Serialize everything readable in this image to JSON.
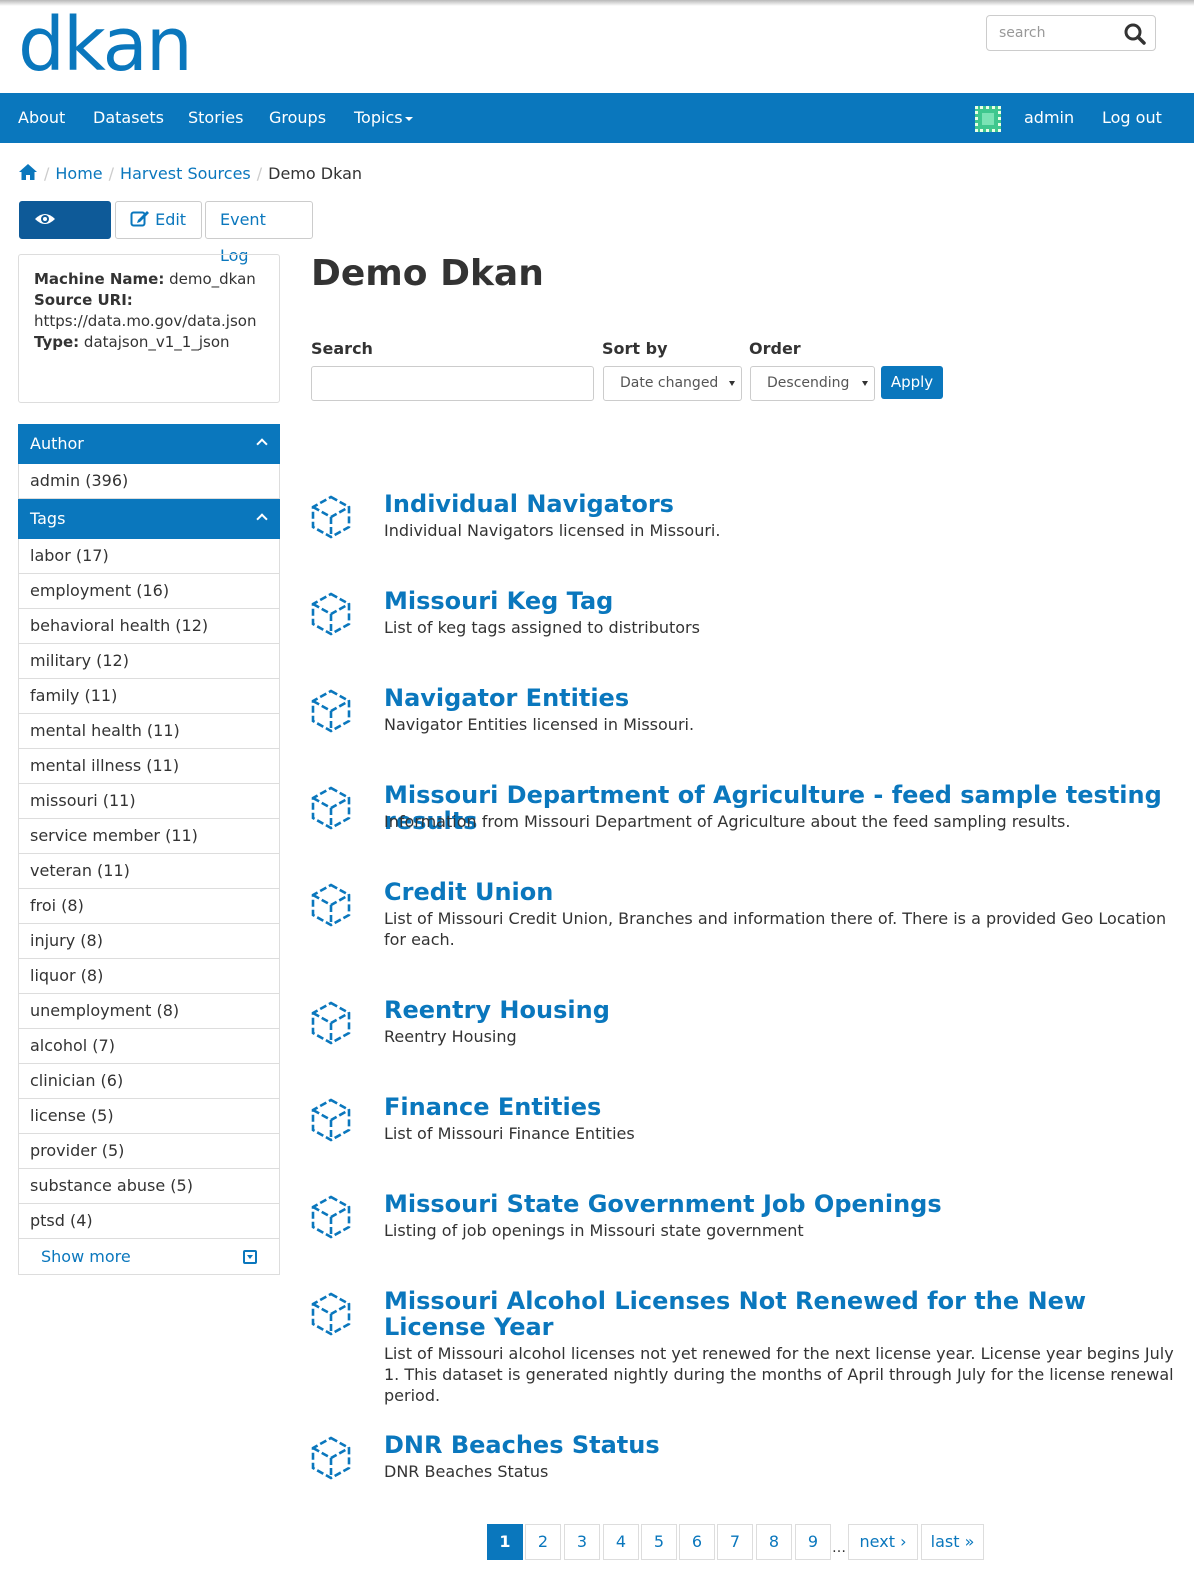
{
  "header": {
    "logo_text": "dkan",
    "search_placeholder": "search"
  },
  "nav": {
    "items": [
      "About",
      "Datasets",
      "Stories",
      "Groups",
      "Topics"
    ],
    "user": "admin",
    "logout": "Log out"
  },
  "breadcrumb": {
    "items": [
      "Home",
      "Harvest Sources"
    ],
    "current": "Demo Dkan"
  },
  "tabs": [
    "View",
    "Edit",
    "Event Log"
  ],
  "info": {
    "machine_name_label": "Machine Name:",
    "machine_name": "demo_dkan",
    "source_uri_label": "Source URI:",
    "source_uri": "https://data.mo.gov/data.json",
    "type_label": "Type:",
    "type": "datajson_v1_1_json"
  },
  "facets": {
    "author_title": "Author",
    "authors": [
      "admin (396)"
    ],
    "tags_title": "Tags",
    "tags": [
      "labor (17)",
      "employment (16)",
      "behavioral health (12)",
      "military (12)",
      "family (11)",
      "mental health (11)",
      "mental illness (11)",
      "missouri (11)",
      "service member (11)",
      "veteran (11)",
      "froi (8)",
      "injury (8)",
      "liquor (8)",
      "unemployment (8)",
      "alcohol (7)",
      "clinician (6)",
      "license (5)",
      "provider (5)",
      "substance abuse (5)",
      "ptsd (4)"
    ],
    "show_more": "Show more"
  },
  "main": {
    "title": "Demo Dkan",
    "filters": {
      "search_label": "Search",
      "sort_label": "Sort by",
      "sort_value": "Date changed",
      "order_label": "Order",
      "order_value": "Descending",
      "apply": "Apply"
    },
    "results": [
      {
        "title": "Individual Navigators",
        "desc": "Individual Navigators licensed in Missouri."
      },
      {
        "title": "Missouri Keg Tag",
        "desc": "List of keg tags assigned to distributors"
      },
      {
        "title": "Navigator Entities",
        "desc": "Navigator Entities licensed in Missouri."
      },
      {
        "title": "Missouri Department of Agriculture - feed sample testing results",
        "desc": "Information from Missouri Department of Agriculture about the feed sampling results."
      },
      {
        "title": "Credit Union",
        "desc": "List of Missouri Credit Union, Branches and information there of. There is a provided Geo Location for each."
      },
      {
        "title": "Reentry Housing",
        "desc": "Reentry Housing"
      },
      {
        "title": "Finance Entities",
        "desc": "List of Missouri Finance Entities"
      },
      {
        "title": "Missouri State Government Job Openings",
        "desc": "Listing of job openings in Missouri state government"
      },
      {
        "title": "Missouri Alcohol Licenses Not Renewed for the New License Year",
        "desc": "List of Missouri alcohol licenses not yet renewed for the next license year. License year begins July 1. This dataset is generated nightly during the months of April through July for the license renewal period."
      },
      {
        "title": "DNR Beaches Status",
        "desc": "DNR Beaches Status"
      }
    ]
  },
  "pager": {
    "pages": [
      "1",
      "2",
      "3",
      "4",
      "5",
      "6",
      "7",
      "8",
      "9"
    ],
    "ellipsis": "…",
    "next": "next ›",
    "last": "last »"
  }
}
